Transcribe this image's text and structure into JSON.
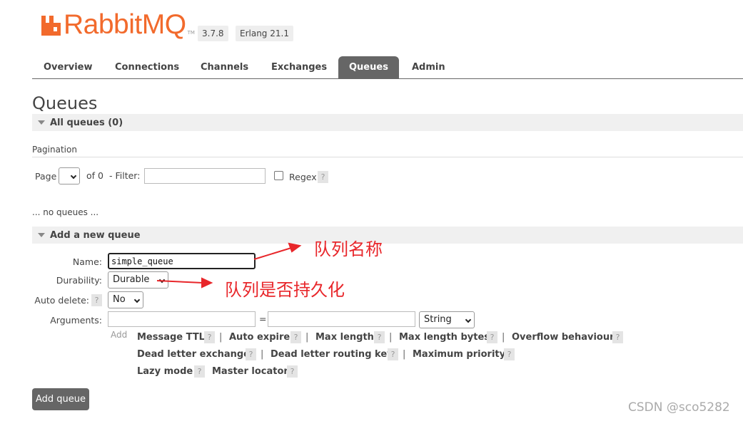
{
  "header": {
    "brand": "RabbitMQ",
    "trademark": "TM",
    "version": "3.7.8",
    "erlang": "Erlang 21.1",
    "brand_color": "#f26a2c"
  },
  "nav": {
    "tabs": [
      {
        "label": "Overview"
      },
      {
        "label": "Connections"
      },
      {
        "label": "Channels"
      },
      {
        "label": "Exchanges"
      },
      {
        "label": "Queues"
      },
      {
        "label": "Admin"
      }
    ],
    "active": "Queues"
  },
  "page": {
    "title": "Queues"
  },
  "all_queues": {
    "title": "All queues (0)",
    "pagination_label": "Pagination",
    "page_label": "Page",
    "of_label": "of 0",
    "filter_label": "- Filter:",
    "filter_value": "",
    "regex_label": "Regex",
    "help": "?",
    "empty_note": "... no queues ..."
  },
  "add_queue": {
    "title": "Add a new queue",
    "name_label": "Name:",
    "name_value": "simple_queue",
    "durability_label": "Durability:",
    "durability_value": "Durable",
    "auto_delete_label": "Auto delete:",
    "auto_delete_value": "No",
    "arguments_label": "Arguments:",
    "equals": "=",
    "arg_type_value": "String",
    "add_label": "Add",
    "argument_links": [
      "Message TTL",
      "Auto expire",
      "Max length",
      "Max length bytes",
      "Overflow behaviour",
      "Dead letter exchange",
      "Dead letter routing key",
      "Maximum priority",
      "Lazy mode",
      "Master locator"
    ],
    "separator": "|",
    "submit_label": "Add queue"
  },
  "annotations": {
    "name_note": "队列名称",
    "durability_note": "队列是否持久化",
    "color": "#e8262a"
  },
  "watermark": "CSDN @sco5282"
}
